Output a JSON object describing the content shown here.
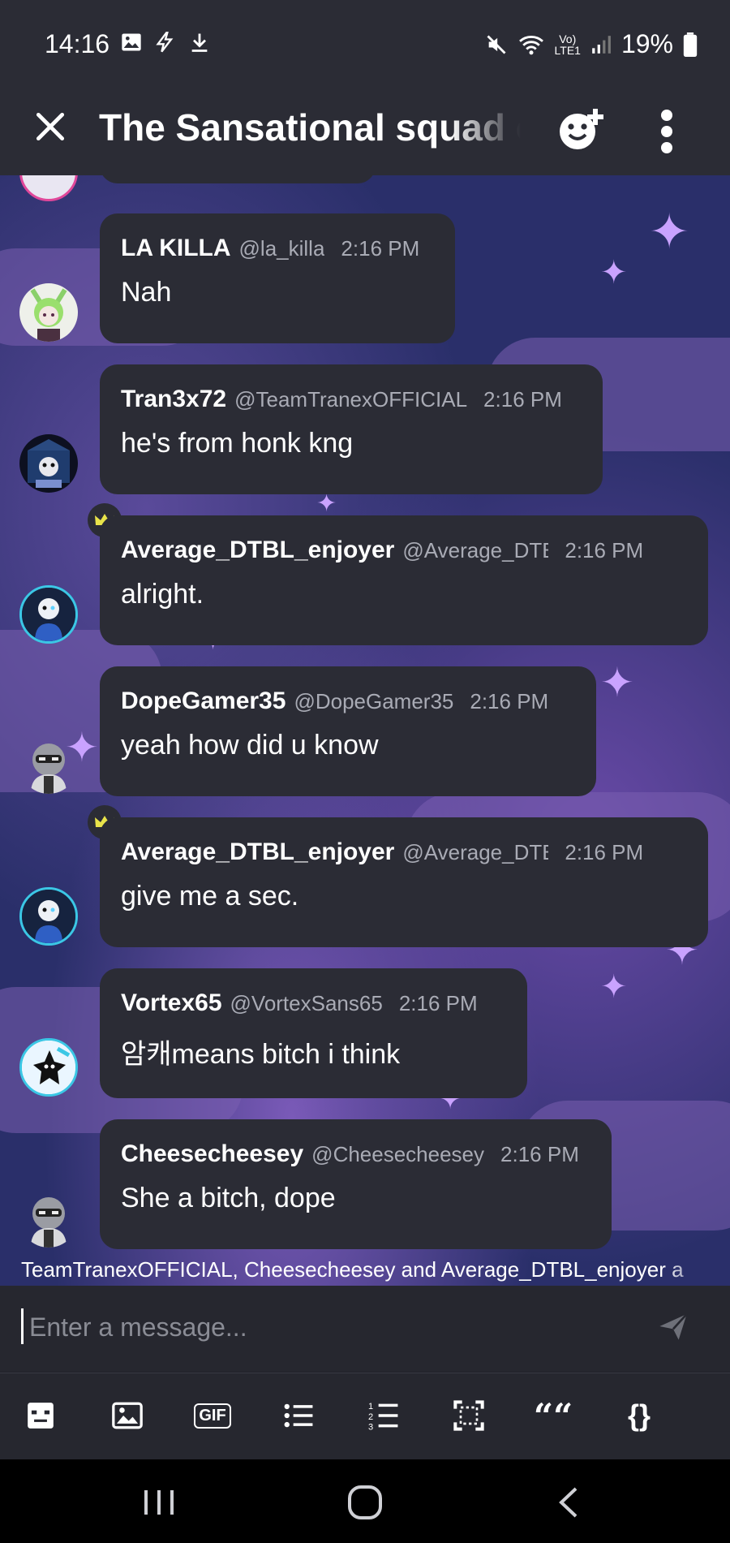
{
  "status_bar": {
    "time": "14:16",
    "battery": "19%",
    "network_line1": "Vo)",
    "network_line2": "LTE1",
    "left_icons": [
      "gallery-icon",
      "bolt-icon",
      "download-icon"
    ],
    "right_icons": [
      "mute-icon",
      "wifi-icon",
      "signal-icon",
      "battery-icon"
    ]
  },
  "header": {
    "title": "The Sansational squad c",
    "close_icon": "close-icon",
    "add_member_icon": "add-member-icon",
    "more_icon": "more-icon"
  },
  "messages": [
    {
      "username": "LA KILLA",
      "handle": "@la_killa",
      "time": "2:16 PM",
      "text": "Nah",
      "crown": false
    },
    {
      "username": "Tran3x72",
      "handle": "@TeamTranexOFFICIAL",
      "time": "2:16 PM",
      "text": "he's from honk kng",
      "crown": false
    },
    {
      "username": "Average_DTBL_enjoyer",
      "handle": "@Average_DTBL",
      "time": "2:16 PM",
      "text": "alright.",
      "crown": true
    },
    {
      "username": "DopeGamer35",
      "handle": "@DopeGamer35",
      "time": "2:16 PM",
      "text": "yeah how did u know",
      "crown": false
    },
    {
      "username": "Average_DTBL_enjoyer",
      "handle": "@Average_DTBL",
      "time": "2:16 PM",
      "text": "give me a sec.",
      "crown": true
    },
    {
      "username": "Vortex65",
      "handle": "@VortexSans65",
      "time": "2:16 PM",
      "text": "암캐means bitch i think",
      "crown": false
    },
    {
      "username": "Cheesecheesey",
      "handle": "@Cheesecheesey",
      "time": "2:16 PM",
      "text": "She a bitch, dope",
      "crown": false
    }
  ],
  "typing_indicator": "TeamTranexOFFICIAL, Cheesecheesey and Average_DTBL_enjoyer a",
  "composer": {
    "placeholder": "Enter a message...",
    "send_icon": "send-icon"
  },
  "toolbar": {
    "gif_label": "GIF",
    "quote_glyph": "““",
    "code_glyph": "{}",
    "items": [
      "sticker-icon",
      "image-icon",
      "gif-icon",
      "bullet-list-icon",
      "numbered-list-icon",
      "spoiler-icon",
      "quote-icon",
      "code-icon"
    ]
  },
  "colors": {
    "bar_bg": "#2b2c35",
    "bubble_bg": "#2b2c35",
    "muted_text": "#a9abb5",
    "crown": "#e8e34a",
    "chat_bg": "#2a2f6a"
  }
}
